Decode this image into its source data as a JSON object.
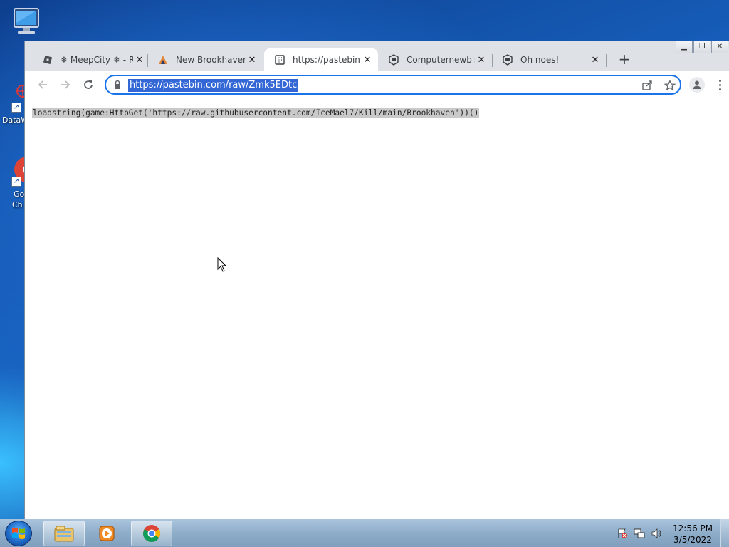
{
  "desktop": {
    "icons": [
      {
        "label": "",
        "icon": "computer-icon"
      },
      {
        "label": "DataW",
        "icon": "dataw-icon"
      },
      {
        "label": "Go",
        "label2": "Ch",
        "icon": "google-chrome-icon"
      }
    ]
  },
  "browser": {
    "tabs": [
      {
        "title": "❄ MeepCity ❄ - R",
        "favicon": "roblox-icon",
        "close": "✕"
      },
      {
        "title": "New Brookhaven",
        "favicon": "brookhaven-icon",
        "close": "✕"
      },
      {
        "title": "https://pastebin.co",
        "favicon": "pastebin-icon",
        "close": "✕",
        "active": true
      },
      {
        "title": "Computernewb's",
        "favicon": "computernewb-icon",
        "close": "✕"
      },
      {
        "title": "Oh noes!",
        "favicon": "computernewb-icon",
        "close": "✕"
      }
    ],
    "new_tab": "+",
    "window_controls": {
      "minimize": "▁",
      "restore": "❐",
      "close": "✕"
    },
    "address_bar": {
      "url": "https://pastebin.com/raw/Zmk5EDtc",
      "selected": true
    },
    "page": {
      "raw_text": "loadstring(game:HttpGet('https://raw.githubusercontent.com/IceMael7/Kill/main/Brookhaven'))()"
    }
  },
  "taskbar": {
    "pinned": [
      "windows-explorer-icon",
      "media-player-icon",
      "google-chrome-icon"
    ],
    "tray": [
      "action-center-flag-icon",
      "network-icon",
      "volume-icon"
    ],
    "clock": {
      "time": "12:56 PM",
      "date": "3/5/2022"
    }
  },
  "colors": {
    "accent": "#1a73e8",
    "selection": "#3367d6",
    "tab_strip": "#dee1e6"
  }
}
